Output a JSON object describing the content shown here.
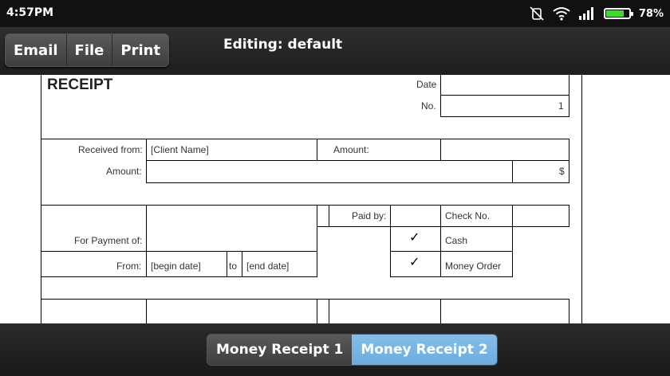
{
  "status": {
    "time": "4:57PM",
    "battery_pct": "78%",
    "battery_level": 0.78
  },
  "icons": [
    "mute-vibrate-icon",
    "wifi-icon",
    "signal-icon",
    "battery-icon"
  ],
  "toolbar": {
    "email": "Email",
    "file": "File",
    "print": "Print",
    "title": "Editing: default"
  },
  "receipt": {
    "title": "RECEIPT",
    "date_label": "Date",
    "no_label": "No.",
    "no_value": "1",
    "received_from_label": "Received from:",
    "client_name": "[Client Name]",
    "amount_label_1": "Amount:",
    "amount_label_2": "Amount:",
    "currency": "$",
    "paid_by_label": "Paid by:",
    "check_no_label": "Check No.",
    "for_payment_label": "For Payment of:",
    "cash_label": "Cash",
    "check_mark": "✓",
    "from_label": "From:",
    "begin_date": "[begin date]",
    "to_label": "to",
    "end_date": "[end date]",
    "money_order_label": "Money Order"
  },
  "tabs": {
    "tab1": "Money Receipt 1",
    "tab2": "Money Receipt 2"
  },
  "colors": {
    "accent": "#6aaee0",
    "battery": "#3ddc2b"
  }
}
